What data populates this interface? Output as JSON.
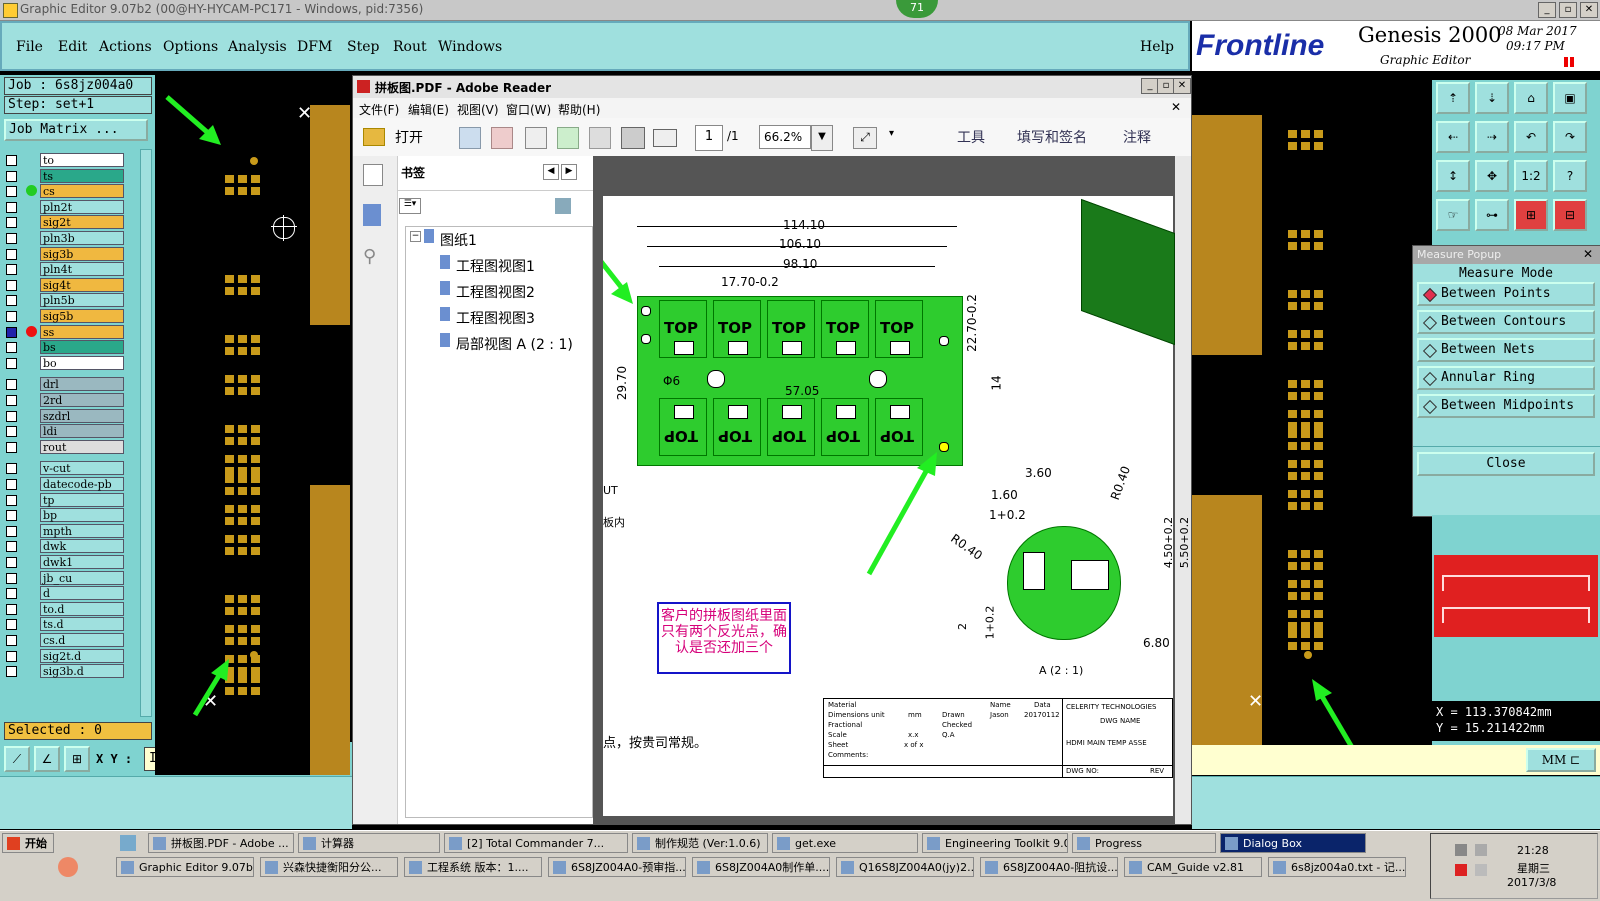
{
  "window": {
    "title": "Graphic Editor 9.07b2 (00@HY-HYCAM-PC171 - Windows, pid:7356)",
    "badge": "71"
  },
  "menubar": {
    "items": [
      "File",
      "Edit",
      "Actions",
      "Options",
      "Analysis",
      "DFM",
      "Step",
      "Rout",
      "Windows"
    ],
    "help": "Help"
  },
  "logo": {
    "brand": "Frontline",
    "product": "Genesis 2000",
    "subtitle": "Graphic Editor",
    "date": "08 Mar 2017",
    "time": "09:17 PM"
  },
  "job": {
    "job_label": "Job : 6s8jz004a0",
    "step_label": "Step: set+1",
    "matrix_button": "Job Matrix ...",
    "selected": "Selected : 0",
    "xy_label": "X Y :",
    "xy_value": "I"
  },
  "layers": [
    {
      "name": "to",
      "color": "#ffffff"
    },
    {
      "name": "ts",
      "color": "#2aa88a"
    },
    {
      "name": "cs",
      "color": "#f0b840"
    },
    {
      "name": "pln2t",
      "color": "#9fe0de"
    },
    {
      "name": "sig2t",
      "color": "#f0b840"
    },
    {
      "name": "pln3b",
      "color": "#9fe0de"
    },
    {
      "name": "sig3b",
      "color": "#f0b840"
    },
    {
      "name": "pln4t",
      "color": "#9fe0de"
    },
    {
      "name": "sig4t",
      "color": "#f0b840"
    },
    {
      "name": "pln5b",
      "color": "#9fe0de"
    },
    {
      "name": "sig5b",
      "color": "#f0b840"
    },
    {
      "name": "ss",
      "color": "#f0b840"
    },
    {
      "name": "bs",
      "color": "#2aa88a"
    },
    {
      "name": "bo",
      "color": "#ffffff"
    },
    {
      "name": "drl",
      "color": "#9ab8c0"
    },
    {
      "name": "2rd",
      "color": "#9ab8c0"
    },
    {
      "name": "szdrl",
      "color": "#9ab8c0"
    },
    {
      "name": "ldi",
      "color": "#9ab8c0"
    },
    {
      "name": "rout",
      "color": "#dddddd"
    },
    {
      "name": "v-cut",
      "color": "#9fe0de"
    },
    {
      "name": "datecode-pb",
      "color": "#9fe0de"
    },
    {
      "name": "tp",
      "color": "#9fe0de"
    },
    {
      "name": "bp",
      "color": "#9fe0de"
    },
    {
      "name": "mpth",
      "color": "#9fe0de"
    },
    {
      "name": "dwk",
      "color": "#9fe0de"
    },
    {
      "name": "dwk1",
      "color": "#9fe0de"
    },
    {
      "name": "jb_cu",
      "color": "#9fe0de"
    },
    {
      "name": "d",
      "color": "#9fe0de"
    },
    {
      "name": "to.d",
      "color": "#9fe0de"
    },
    {
      "name": "ts.d",
      "color": "#9fe0de"
    },
    {
      "name": "cs.d",
      "color": "#9fe0de"
    },
    {
      "name": "sig2t.d",
      "color": "#9fe0de"
    },
    {
      "name": "sig3b.d",
      "color": "#9fe0de"
    }
  ],
  "pdf": {
    "title": "拼板图.PDF - Adobe Reader",
    "menu": [
      "文件(F)",
      "编辑(E)",
      "视图(V)",
      "窗口(W)",
      "帮助(H)"
    ],
    "open_label": "打开",
    "page_current": "1",
    "page_total": "/1",
    "zoom": "66.2%",
    "tools_label": "工具",
    "fill_sign_label": "填写和签名",
    "comment_label": "注释",
    "bookmarks_label": "书签",
    "tree": [
      "图纸1",
      "工程图视图1",
      "工程图视图2",
      "工程图视图3",
      "局部视图 A (2 : 1)"
    ],
    "dims": [
      "114.10",
      "106.10",
      "98.10",
      "17.70-0.2",
      "57.05",
      "29.70",
      "22.70-0.2",
      "14",
      "3.60",
      "1.60",
      "1+0.2",
      "R0.40",
      "R0.40",
      "4.50+0.2",
      "5.50+0.2",
      "6.80",
      "2",
      "1+0.2"
    ],
    "phi": "Φ6",
    "top_label": "TOP",
    "note": "客户的拼板图纸里面只有两个反光点，确认是否还加三个",
    "detail_label": "A (2 : 1)",
    "footer_text": "点，按贵司常规。",
    "left_texts": [
      "UT",
      "板内"
    ],
    "titleblock": {
      "company": "CELERITY TECHNOLOGIES",
      "dwg_name": "DWG NAME",
      "part": "HDMI MAIN TEMP ASSE",
      "dwg_no": "DWG NO:",
      "rev": "REV",
      "material": "Material",
      "dim_unit": "Dimensions unit",
      "mm": "mm",
      "fractional": "Fractional",
      "scale": "Scale",
      "sheet": "Sheet",
      "comments": "Comments:",
      "xx": "x.x",
      "xofx": "x of x",
      "name": "Name",
      "data": "Data",
      "drawn": "Drawn",
      "jason": "Jason",
      "date": "20170112",
      "checked": "Checked",
      "qa": "Q.A"
    }
  },
  "measure": {
    "title": "Measure Popup",
    "mode": "Measure Mode",
    "options": [
      "Between Points",
      "Between Contours",
      "Between Nets",
      "Annular Ring",
      "Between Midpoints"
    ],
    "close": "Close"
  },
  "tools": [
    "⇡",
    "⇣",
    "⌂",
    "▣",
    "⇠",
    "⇢",
    "↶",
    "↷",
    "↕",
    "✥",
    "1:2",
    "?",
    "☞",
    "⊶",
    "⊞",
    "⊟"
  ],
  "coords": {
    "x": "X = 113.370842mm",
    "y": "Y = 15.211422mm",
    "unit": "MM"
  },
  "taskbar": {
    "start": "开始",
    "row1": [
      "拼板图.PDF - Adobe ...",
      "计算器",
      "[2] Total Commander 7...",
      "制作规范 (Ver:1.0.6)",
      "get.exe",
      "Engineering Toolkit 9.0...",
      "Progress",
      "Dialog Box"
    ],
    "row2": [
      "Graphic Editor 9.07b...",
      "兴森快捷衡阳分公...",
      "工程系统  版本：1....",
      "6S8JZ004A0-预审指...",
      "6S8JZ004A0制作单....",
      "Q16S8JZ004A0(jy)2...",
      "6S8JZ004A0-阻抗设...",
      "CAM_Guide v2.81",
      "6s8jz004a0.txt - 记..."
    ],
    "clock_time": "21:28",
    "clock_day": "星期三",
    "clock_date": "2017/3/8"
  },
  "colors": {
    "accent": "#9fe0de",
    "board_green": "#2ecc2e",
    "arrow": "#22ee22",
    "note_text": "#d6007a"
  }
}
